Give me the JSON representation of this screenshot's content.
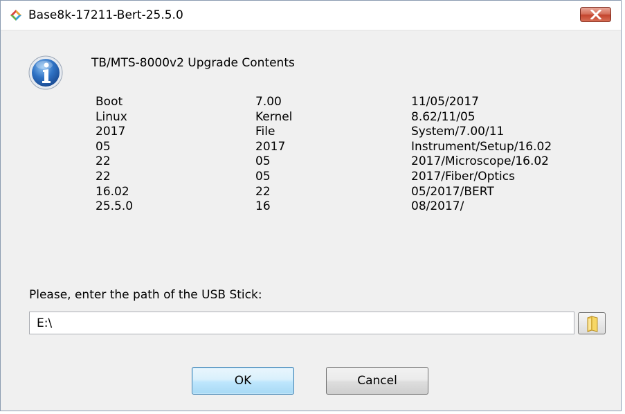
{
  "window": {
    "title": "Base8k-17211-Bert-25.5.0",
    "app_icon": "colored-diamond-logo-icon",
    "close_icon": "close-icon"
  },
  "message": {
    "icon": "info-icon",
    "heading": "TB/MTS-8000v2 Upgrade Contents",
    "rows": [
      [
        "Boot",
        "7.00",
        "11/05/2017"
      ],
      [
        "Linux",
        "Kernel",
        "8.62/11/05"
      ],
      [
        "2017",
        "File",
        "System/7.00/11"
      ],
      [
        "05",
        "2017",
        "Instrument/Setup/16.02"
      ],
      [
        "22",
        "05",
        "2017/Microscope/16.02"
      ],
      [
        "22",
        "05",
        "2017/Fiber/Optics"
      ],
      [
        "16.02",
        "22",
        "05/2017/BERT"
      ],
      [
        "25.5.0",
        "16",
        "08/2017/"
      ]
    ]
  },
  "usb": {
    "prompt": "Please, enter the path of the USB Stick:",
    "path_value": "E:\\",
    "browse_icon": "folder-icon"
  },
  "buttons": {
    "ok_label": "OK",
    "cancel_label": "Cancel"
  },
  "colors": {
    "dialog_background": "#f0f0f0",
    "close_button": "#c4452f",
    "ok_button_accent": "#3c7fb1",
    "info_icon_blue": "#2b67b8"
  }
}
